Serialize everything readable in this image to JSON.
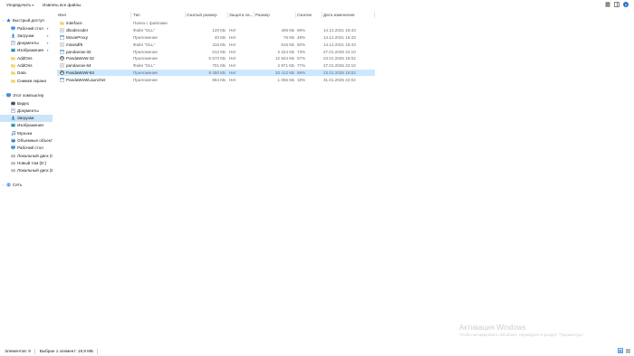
{
  "toolbar": {
    "organize_label": "Упорядочить",
    "select_all_label": "Извлечь все файлы"
  },
  "nav": {
    "items": [
      {
        "label": "Быстрый доступ",
        "icon": "star-icon",
        "level": 0,
        "pinned": false,
        "chevron": true
      },
      {
        "label": "Рабочий стол",
        "icon": "desktop-icon",
        "level": 1,
        "pinned": true
      },
      {
        "label": "Загрузки",
        "icon": "download-icon",
        "level": 1,
        "pinned": true
      },
      {
        "label": "Документы",
        "icon": "document-icon",
        "level": 1,
        "pinned": true
      },
      {
        "label": "Изображения",
        "icon": "image-icon",
        "level": 1,
        "pinned": true
      },
      {
        "label": "AddOns",
        "icon": "folder-icon",
        "level": 1,
        "pinned": false
      },
      {
        "label": "AddOns",
        "icon": "folder-icon",
        "level": 1,
        "pinned": false
      },
      {
        "label": "Data",
        "icon": "folder-icon",
        "level": 1,
        "pinned": false
      },
      {
        "label": "Снимки экрана",
        "icon": "folder-icon",
        "level": 1,
        "pinned": false
      },
      {
        "label": "Этот компьютер",
        "icon": "computer-icon",
        "level": 0,
        "pinned": false,
        "chevron": true
      },
      {
        "label": "Видео",
        "icon": "video-icon",
        "level": 1,
        "pinned": false
      },
      {
        "label": "Документы",
        "icon": "document-icon",
        "level": 1,
        "pinned": false
      },
      {
        "label": "Загрузки",
        "icon": "download-icon",
        "level": 1,
        "pinned": false,
        "selected": true
      },
      {
        "label": "Изображения",
        "icon": "image-icon",
        "level": 1,
        "pinned": false
      },
      {
        "label": "Музыка",
        "icon": "music-icon",
        "level": 1,
        "pinned": false
      },
      {
        "label": "Объемные объекты",
        "icon": "cube-icon",
        "level": 1,
        "pinned": false
      },
      {
        "label": "Рабочий стол",
        "icon": "desktop-icon",
        "level": 1,
        "pinned": false
      },
      {
        "label": "Локальный диск (C:)",
        "icon": "drive-icon",
        "level": 1,
        "pinned": false
      },
      {
        "label": "Новый том (D:)",
        "icon": "drive-icon",
        "level": 1,
        "pinned": false
      },
      {
        "label": "Локальный диск (E:)",
        "icon": "drive-icon",
        "level": 1,
        "pinned": false
      },
      {
        "label": "Сеть",
        "icon": "network-icon",
        "level": 0,
        "pinned": false,
        "chevron": true
      }
    ]
  },
  "columns": {
    "name": "Имя",
    "type": "Тип",
    "packed_size": "Сжатый размер",
    "password": "Защита па...",
    "size": "Размер",
    "ratio": "Сжатие",
    "date": "Дата изменения"
  },
  "files": [
    {
      "name": "interface",
      "type": "Папка с файлами",
      "packed": "",
      "password": "",
      "size": "",
      "ratio": "",
      "date": "",
      "icon": "folder-icon"
    },
    {
      "name": "dbodecoder",
      "type": "Файл \"DLL\"",
      "packed": "120 КБ",
      "password": "Нет",
      "size": "406 КБ",
      "ratio": "69%",
      "date": "14.12.2021 18:43",
      "icon": "dll-file-icon"
    },
    {
      "name": "MovieProxy",
      "type": "Приложение",
      "packed": "40 КБ",
      "password": "Нет",
      "size": "76 КБ",
      "ratio": "48%",
      "date": "14.12.2021 18:43",
      "icon": "app-icon"
    },
    {
      "name": "mswsdf8",
      "type": "Файл \"DLL\"",
      "packed": "315 КБ",
      "password": "Нет",
      "size": "616 КБ",
      "ratio": "50%",
      "date": "14.12.2021 18:43",
      "icon": "dll-file-icon"
    },
    {
      "name": "pandavow-32",
      "type": "Приложение",
      "packed": "612 КБ",
      "password": "Нет",
      "size": "2 224 КБ",
      "ratio": "73%",
      "date": "27.01.2025 22:10",
      "icon": "app-icon"
    },
    {
      "name": "PandaWoW-32",
      "type": "Приложение",
      "packed": "5 570 КБ",
      "password": "Нет",
      "size": "12 844 КБ",
      "ratio": "57%",
      "date": "23.01.2025 18:02",
      "icon": "panda-app-icon"
    },
    {
      "name": "pandavow-64",
      "type": "Файл \"DLL\"",
      "packed": "701 КБ",
      "password": "Нет",
      "size": "2 971 КБ",
      "ratio": "77%",
      "date": "27.01.2025 22:10",
      "icon": "dll-file-icon"
    },
    {
      "name": "PandaWoW-64",
      "type": "Приложение",
      "packed": "8 450 КБ",
      "password": "Нет",
      "size": "20 412 КБ",
      "ratio": "59%",
      "date": "23.01.2025 18:02",
      "icon": "panda-app-icon",
      "selected": true
    },
    {
      "name": "PandaWoWLauncher",
      "type": "Приложение",
      "packed": "864 КБ",
      "password": "Нет",
      "size": "1 055 КБ",
      "ratio": "18%",
      "date": "31.01.2025 22:02",
      "icon": "app-icon"
    }
  ],
  "status": {
    "items_count": "Элементов: 9",
    "selected": "Выбран 1 элемент: 19,9 МБ"
  },
  "watermark": {
    "title": "Активация Windows",
    "subtitle": "Чтобы активировать Windows, перейдите в раздел \"Параметры\"."
  },
  "colors": {
    "selection": "#cce8ff",
    "nav_selection": "#cce4f7",
    "folder": "#f2c94c",
    "accent": "#2a73c9"
  }
}
